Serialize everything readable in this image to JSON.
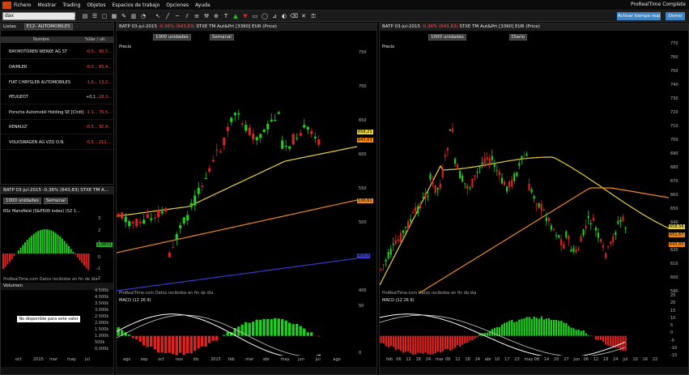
{
  "menu": {
    "items": [
      "Fichero",
      "Mostrar",
      "Trading",
      "Objetos",
      "Espacios de trabajo",
      "Opciones",
      "Ayuda"
    ],
    "brand": "ProRealTime Complete"
  },
  "toolbar": {
    "search_value": "dax",
    "realtime_button": "Activar tiempo real",
    "demo_button": "Demo"
  },
  "watchlist": {
    "tab": "Listas",
    "list_name": "E12- AUTOMOBILES",
    "col_name": "Nombre",
    "col_var": "%Var / ult.",
    "items": [
      {
        "name": "BAY.MOTOREN WERKE AG ST",
        "var": "-0,5...",
        "last": "90,5..."
      },
      {
        "name": "DAIMLER",
        "var": "-0,0...",
        "last": "83,4..."
      },
      {
        "name": "FIAT CHRYSLER AUTOMOBILES",
        "var": "-1,6...",
        "last": "13,2..."
      },
      {
        "name": "PEUGEOT",
        "var": "+0,1...",
        "last": "18,3..."
      },
      {
        "name": "Porsche Automobil Holding SE [Chdt]",
        "var": "-1,1...",
        "last": "76,5..."
      },
      {
        "name": "RENAULT",
        "var": "-0,5...",
        "last": "92,9..."
      },
      {
        "name": "VOLKSWAGEN AG VZO O.N.",
        "var": "-0,5...",
        "last": "212,..."
      }
    ]
  },
  "mini": {
    "header": "BATP  03-jul-2015  -0,36% (643,83)  STXE TM A...",
    "units": "1000 unidades",
    "period": "Semanal",
    "indicator_title": "RSc Mansfield (S&P500 index) (52 1...",
    "ticks": [
      "3",
      "2",
      "1",
      "0",
      "-1",
      "-2"
    ],
    "value": "1,0872",
    "footer": "ProRealTime.com  Datos recibidos en fin de día",
    "volume_title": "Volumen",
    "not_available": "No disponible para este valor",
    "vol_ticks": [
      "4.500k",
      "4.000k",
      "3.500k",
      "3.000k",
      "2.500k",
      "2.000k",
      "1.500k",
      "1.000k",
      "500k",
      "0,000k"
    ],
    "xlabels": [
      "oct",
      "2015",
      "mar",
      "may",
      "jul"
    ]
  },
  "weekly": {
    "header_ticker": "BATP",
    "header_date": "03-jul-2015",
    "header_change": "-0,36% (643,83)",
    "header_name": "STXE TM Aut&Prt [3360] EUR (Price)",
    "units": "1000 unidades",
    "period": "Semanal",
    "price_label": "Precio",
    "macd_label": "MACD (12 26 9)",
    "footer": "ProRealTime.com  Datos recibidos en fin de día",
    "price_ticks": [
      "750",
      "700",
      "650",
      "600",
      "550",
      "500",
      "450",
      "400"
    ],
    "price_tags": {
      "last": "643,83",
      "ma1": "658,21",
      "ma2": "536,61",
      "ma3": "450,0"
    },
    "macd_ticks": [
      "50",
      "0"
    ],
    "macd_tags": {
      "a": "27,0?",
      "b": "10,611",
      "c": "1,020"
    },
    "xlabels": [
      "ago",
      "sep",
      "oct",
      "nov",
      "dic",
      "2015",
      "feb",
      "mar",
      "abr",
      "may",
      "jun",
      "jul",
      "ago"
    ],
    "colors": {
      "up": "#22cc22",
      "down": "#dd2222",
      "ma_yellow": "#e6d23c",
      "ma_orange": "#ee8a1e",
      "ma_blue": "#3838cc"
    }
  },
  "daily": {
    "header_ticker": "BATP",
    "header_date": "03-jul-2015",
    "header_change": "-0,36% (643,83)",
    "header_name": "STXE TM Aut&Prt [3360] EUR (Price)",
    "units": "1000 unidades",
    "period": "Diario",
    "price_label": "Precio",
    "macd_label": "MACD (12 26 9)",
    "footer": "ProRealTime.com  Datos recibidos en fin de día",
    "price_ticks": [
      "770",
      "760",
      "750",
      "740",
      "730",
      "720",
      "710",
      "700",
      "690",
      "680",
      "670",
      "660",
      "650",
      "640",
      "630",
      "620",
      "610",
      "600",
      "590"
    ],
    "price_tags": {
      "ma1": "658,56",
      "ma2": "651,67",
      "last": "643,83"
    },
    "macd_ticks": [
      "25",
      "20",
      "15",
      "10",
      "5",
      "0",
      "-5",
      "-10",
      "-15"
    ],
    "macd_tags": {
      "a": "-1,1???",
      "b": "-4,090"
    },
    "xlabels": [
      "feb",
      "06",
      "12",
      "18",
      "24",
      "mar",
      "06",
      "12",
      "18",
      "24",
      "abr",
      "10",
      "17",
      "23",
      "may",
      "08",
      "14",
      "20",
      "27",
      "jun",
      "06",
      "12",
      "18",
      "24",
      "jul",
      "10",
      "16",
      "22"
    ]
  }
}
